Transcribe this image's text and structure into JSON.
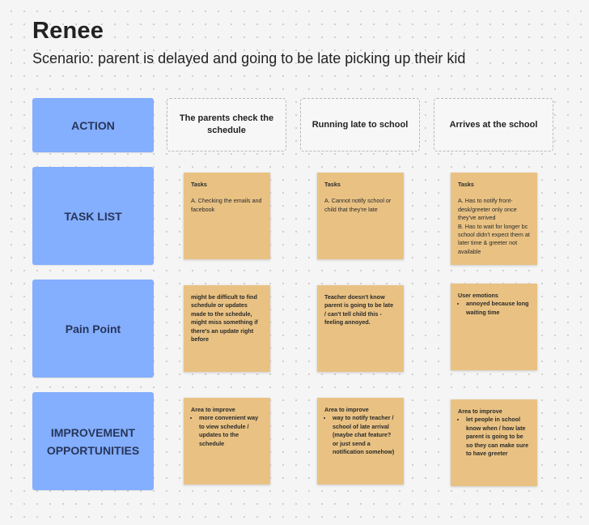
{
  "header": {
    "title": "Renee",
    "scenario": "Scenario: parent is delayed and going to be late picking up their kid"
  },
  "rows": {
    "action": "ACTION",
    "task_list": "TASK LIST",
    "pain_point": "Pain Point",
    "improvement_line1": "IMPROVEMENT",
    "improvement_line2": "OPPORTUNITIES"
  },
  "columns": [
    "The parents check the schedule",
    "Running late to school",
    "Arrives at the school"
  ],
  "tasks": [
    {
      "heading": "Tasks",
      "items": [
        "A.  Checking the emails and facebook"
      ]
    },
    {
      "heading": "Tasks",
      "items": [
        "A. Cannot notify school or child that they're late"
      ]
    },
    {
      "heading": "Tasks",
      "items": [
        "A. Has to notify front-desk/greeter only once they've arrived",
        "B. Has to wait for longer bc school didn't expect them at later time & greeter not available"
      ]
    }
  ],
  "pain_points": [
    {
      "text": "might be difficult to find schedule or updates made to the schedule, might miss something if there's an update right before"
    },
    {
      "text": "Teacher doesn't know parent is going to be late / can't tell child this - feeling annoyed."
    },
    {
      "heading": "User emotions",
      "bullet": "annoyed because long waiting time"
    }
  ],
  "improvements": [
    {
      "heading": "Area to improve",
      "bullet": "more convenient way to view schedule / updates to the schedule"
    },
    {
      "heading": "Area to improve",
      "bullet": "way to notify teacher / school of late arrival (maybe chat feature? or just send a notification somehow)"
    },
    {
      "heading": "Area to improve",
      "bullet": "let people in school know when / how late parent is going to be so they can make sure to have greeter"
    }
  ]
}
